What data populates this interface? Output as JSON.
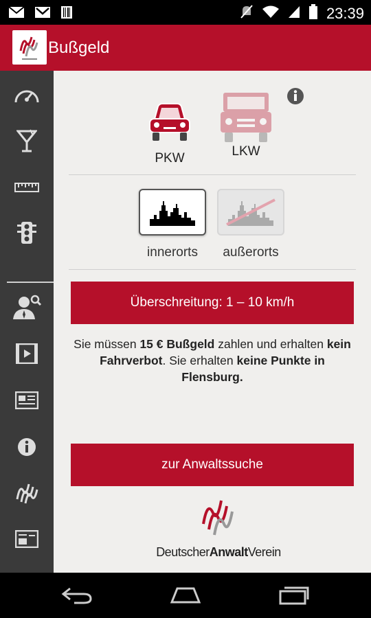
{
  "status_bar": {
    "time": "23:39",
    "icons": [
      "mail-icon",
      "gmail-icon",
      "barcode-icon",
      "mute-icon",
      "wifi-icon",
      "signal-icon",
      "battery-icon"
    ]
  },
  "app_bar": {
    "title": "Bußgeld",
    "logo": "dav-logo"
  },
  "sidebar": {
    "items": [
      "speedometer-icon",
      "cocktail-icon",
      "ruler-icon",
      "traffic-light-icon",
      "lawyer-search-icon",
      "video-icon",
      "news-icon",
      "info-icon",
      "dav-icon",
      "card-icon"
    ]
  },
  "vehicle": {
    "pkw_label": "PKW",
    "lkw_label": "LKW",
    "selected": "PKW"
  },
  "zone": {
    "inner_label": "innerorts",
    "outer_label": "außerorts",
    "selected": "innerorts"
  },
  "violation_button": "Überschreitung: 1 – 10 km/h",
  "result": {
    "p1": "Sie müssen ",
    "fine": "15 € Bußgeld",
    "p2": " zahlen und erhalten ",
    "ban": "kein Fahrverbot",
    "p3": ". Sie erhalten ",
    "points": "keine Punkte in Flensburg."
  },
  "lawyer_button": "zur Anwaltssuche",
  "dav": {
    "word1": "Deutscher",
    "word2": "Anwalt",
    "word3": "Verein"
  },
  "colors": {
    "accent": "#b5102a",
    "sidebar": "#3a3a3a",
    "background": "#f0efed"
  }
}
